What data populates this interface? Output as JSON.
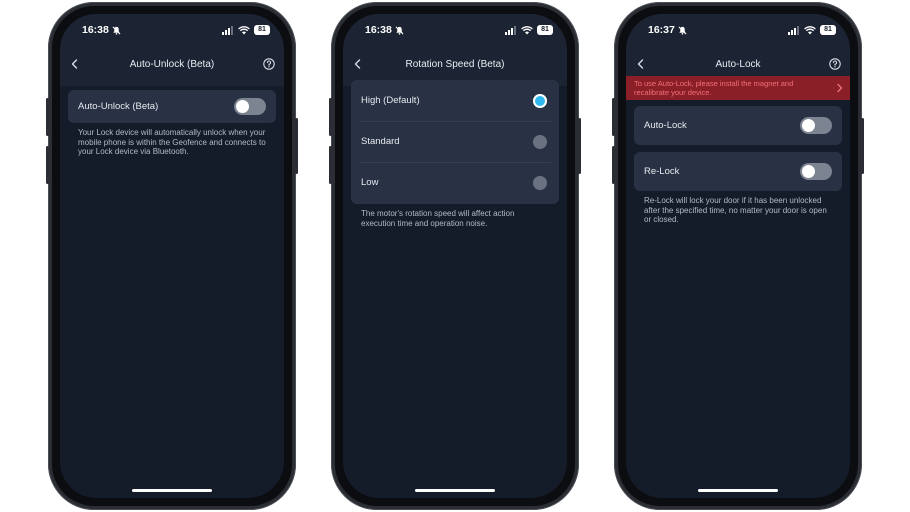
{
  "screens": [
    {
      "time": "16:38",
      "battery": "81",
      "title": "Auto-Unlock (Beta)",
      "toggle_label": "Auto-Unlock (Beta)",
      "toggle_on": false,
      "description": "Your Lock device will automatically unlock when your mobile phone is within the Geofence and connects to your Lock device via Bluetooth."
    },
    {
      "time": "16:38",
      "battery": "81",
      "title": "Rotation Speed (Beta)",
      "options": [
        {
          "label": "High (Default)",
          "selected": true
        },
        {
          "label": "Standard",
          "selected": false
        },
        {
          "label": "Low",
          "selected": false
        }
      ],
      "description": "The motor's rotation speed will affect action execution time and operation noise."
    },
    {
      "time": "16:37",
      "battery": "81",
      "title": "Auto-Lock",
      "banner": "To use Auto-Lock, please install the magnet and recalibrate your device.",
      "toggles": [
        {
          "label": "Auto-Lock",
          "on": false
        },
        {
          "label": "Re-Lock",
          "on": false
        }
      ],
      "description": "Re-Lock will lock your door if it has been unlocked after the specified time, no matter your door is open or closed."
    }
  ],
  "colors": {
    "background": "#141b29",
    "header": "#1c2333",
    "card": "#283244",
    "accent": "#2fb7f0",
    "warning_banner": "#8b1f28",
    "warning_text": "#f0707a"
  },
  "icons": {
    "status": [
      "bell-slash-icon",
      "cellular-signal-icon",
      "wifi-icon",
      "battery-icon"
    ],
    "nav": [
      "back-chevron-icon",
      "help-icon"
    ],
    "banner": "chevron-right-icon"
  }
}
